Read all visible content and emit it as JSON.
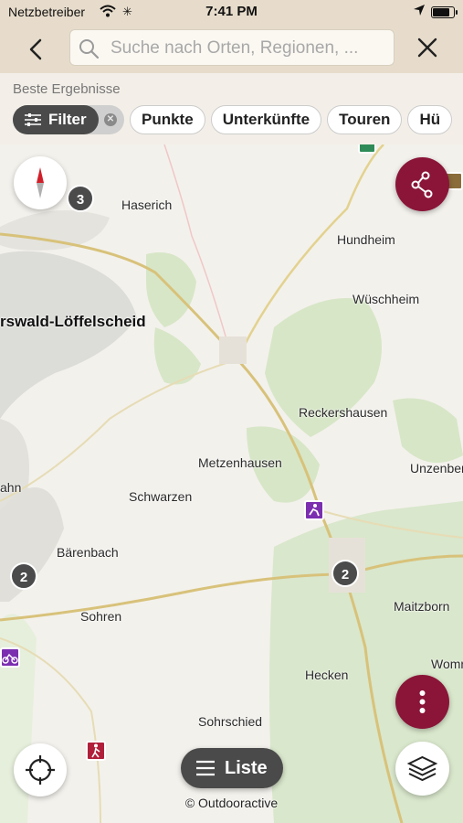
{
  "status_bar": {
    "carrier": "Netzbetreiber",
    "time": "7:41 PM",
    "battery_level": 0.9
  },
  "search": {
    "placeholder": "Suche nach Orten, Regionen, ..."
  },
  "results": {
    "label": "Beste Ergebnisse",
    "filter_label": "Filter",
    "chips": [
      "Punkte",
      "Unterkünfte",
      "Touren",
      "Hü"
    ]
  },
  "map": {
    "places": {
      "haserich": "Haserich",
      "hundheim": "Hundheim",
      "wuschheim": "Wüschheim",
      "lofflescheid": "rswald-Löffelscheid",
      "reckershausen": "Reckershausen",
      "metzenhausen": "Metzenhausen",
      "unzenberg": "Unzenberg",
      "ahn": "ahn",
      "schwarzen": "Schwarzen",
      "barenbach": "Bärenbach",
      "maitzborn": "Maitzborn",
      "sohren": "Sohren",
      "womr": "Womr",
      "hecken": "Hecken",
      "sohrschied": "Sohrschied"
    },
    "clusters": {
      "top": "3",
      "left": "2",
      "right": "2"
    }
  },
  "list_button": {
    "label": "Liste"
  },
  "attribution": "© Outdooractive",
  "colors": {
    "accent": "#8a1538",
    "header_bg": "#e7dccb",
    "chip_dark": "#4a4a4a",
    "forest": "#d6e6c4",
    "poi_purple": "#7b2fb0",
    "poi_red": "#b0203a"
  }
}
